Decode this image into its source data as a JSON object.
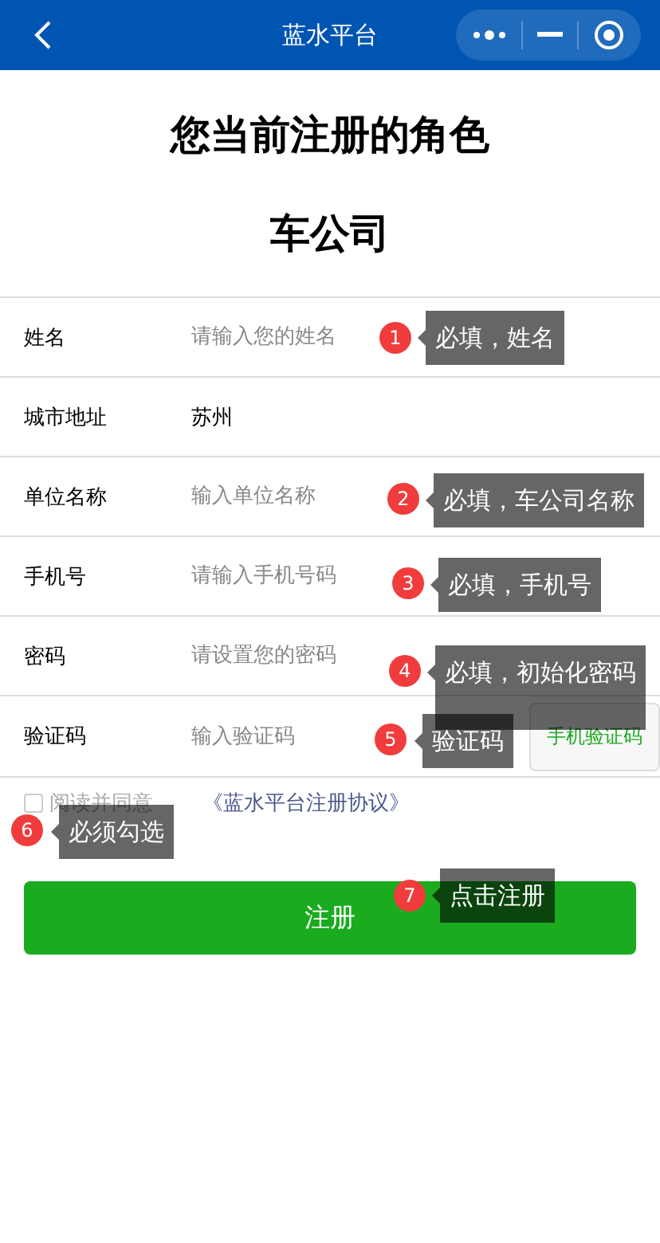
{
  "nav": {
    "title": "蓝水平台"
  },
  "heading": "您当前注册的角色",
  "role": "车公司",
  "fields": [
    {
      "label": "姓名",
      "placeholder": "请输入您的姓名"
    },
    {
      "label": "城市地址",
      "value": "苏州"
    },
    {
      "label": "单位名称",
      "placeholder": "输入单位名称"
    },
    {
      "label": "手机号",
      "placeholder": "请输入手机号码"
    },
    {
      "label": "密码",
      "placeholder": "请设置您的密码"
    },
    {
      "label": "验证码",
      "placeholder": "输入验证码",
      "button": "手机验证码"
    }
  ],
  "agreement": {
    "checked": false,
    "text": "阅读并同意",
    "link": "《蓝水平台注册协议》"
  },
  "submit": "注册",
  "annotations": [
    {
      "number": "1",
      "text": "必填，姓名"
    },
    {
      "number": "2",
      "text": "必填，车公司名称"
    },
    {
      "number": "3",
      "text": "必填，手机号"
    },
    {
      "number": "4",
      "text": "必填，初始化密码"
    },
    {
      "number": "5",
      "text": "验证码"
    },
    {
      "number": "6",
      "text": "必须勾选"
    },
    {
      "number": "7",
      "text": "点击注册"
    }
  ]
}
